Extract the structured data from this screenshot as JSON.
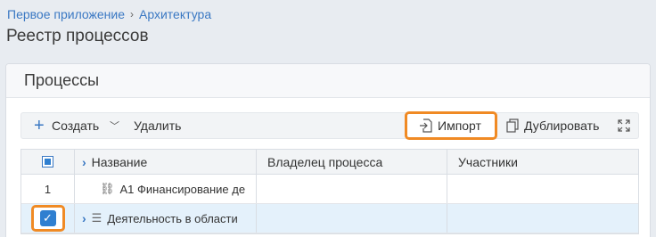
{
  "breadcrumb": {
    "items": [
      "Первое приложение",
      "Архитектура"
    ],
    "separator": "›"
  },
  "page_title": "Реестр процессов",
  "card": {
    "title": "Процессы"
  },
  "toolbar": {
    "create_label": "Создать",
    "delete_label": "Удалить",
    "import_label": "Импорт",
    "duplicate_label": "Дублировать"
  },
  "table": {
    "columns": [
      "Название",
      "Владелец процесса",
      "Участники"
    ],
    "rows": [
      {
        "num": "1",
        "name": "А1 Финансирование де",
        "owner": "",
        "participants": ""
      },
      {
        "name": "Деятельность в области",
        "owner": "",
        "participants": "",
        "selected": true
      }
    ]
  },
  "colors": {
    "accent": "#3a78c3",
    "highlight": "#f08a24",
    "checkbox": "#2f7fd0",
    "selected_row": "#e4f1fb"
  }
}
